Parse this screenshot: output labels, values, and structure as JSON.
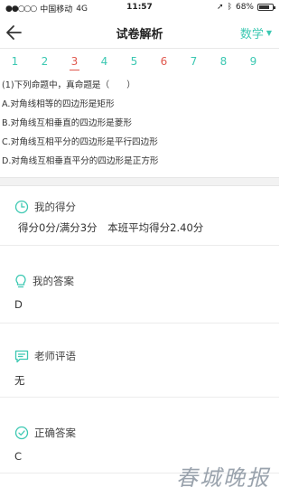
{
  "status_bar": {
    "carrier": "中国移动",
    "network": "4G",
    "time": "11:57",
    "battery": "68%",
    "battery_level": 0.68
  },
  "nav": {
    "title": "试卷解析",
    "subject": "数学"
  },
  "question_numbers": [
    {
      "label": "1",
      "status": "correct"
    },
    {
      "label": "2",
      "status": "correct"
    },
    {
      "label": "3",
      "status": "wrong"
    },
    {
      "label": "4",
      "status": "correct"
    },
    {
      "label": "5",
      "status": "correct"
    },
    {
      "label": "6",
      "status": "wrong"
    },
    {
      "label": "7",
      "status": "correct"
    },
    {
      "label": "8",
      "status": "correct"
    },
    {
      "label": "9",
      "status": "correct"
    }
  ],
  "question": {
    "stem": "(1)下列命题中，真命题是（　　）",
    "options": [
      "A.对角线相等的四边形是矩形",
      "B.对角线互相垂直的四边形是菱形",
      "C.对角线互相平分的四边形是平行四边形",
      "D.对角线互相垂直平分的四边形是正方形"
    ]
  },
  "score": {
    "label": "我的得分",
    "value": "得分0分/满分3分",
    "class_avg": "本班平均得分2.40分"
  },
  "my_answer": {
    "label": "我的答案",
    "value": "D"
  },
  "teacher_comment": {
    "label": "老师评语",
    "value": "无"
  },
  "correct_answer": {
    "label": "正确答案",
    "value": "C"
  },
  "watermark": "春城晚报",
  "colors": {
    "accent": "#3cc8b2",
    "wrong": "#e0584e"
  }
}
